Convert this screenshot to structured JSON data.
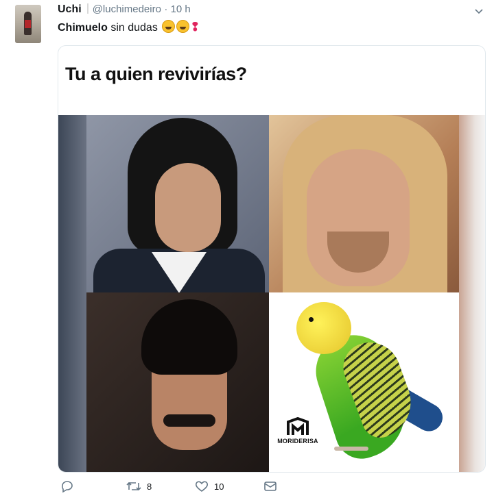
{
  "tweet": {
    "user_name": "Uchi",
    "handle": "@luchimedeiro",
    "time": "· 10 h",
    "text_bold": "Chimuelo",
    "text_rest": " sin dudas",
    "text_suffix": "❢"
  },
  "card": {
    "question": "Tu a quien revivirías?",
    "watermark": "MORIDERISA"
  },
  "actions": {
    "reply_count": "",
    "retweet_count": "8",
    "like_count": "10"
  },
  "colors": {
    "secondary_text": "#657786",
    "like_heart": "#e0245e"
  }
}
